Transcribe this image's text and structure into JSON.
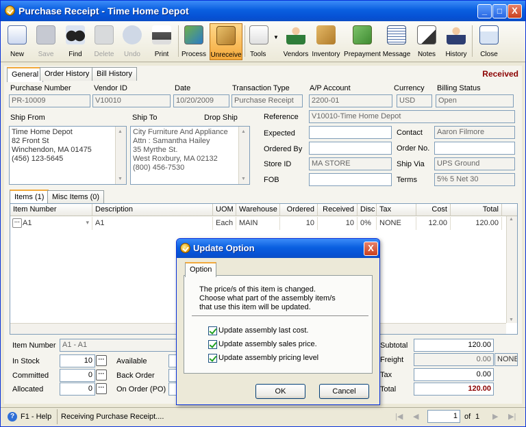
{
  "window": {
    "title": "Purchase Receipt - Time Home Depot",
    "minimize": "_",
    "maximize": "□",
    "close": "X"
  },
  "toolbar": [
    {
      "label": "New",
      "icon": "new-document-icon",
      "enabled": true
    },
    {
      "label": "Save",
      "icon": "save-disk-icon",
      "enabled": false
    },
    {
      "label": "Find",
      "icon": "binoculars-icon",
      "enabled": true
    },
    {
      "label": "Delete",
      "icon": "trash-icon",
      "enabled": false
    },
    {
      "label": "Undo",
      "icon": "undo-icon",
      "enabled": false
    },
    {
      "label": "Print",
      "icon": "printer-icon",
      "enabled": true
    },
    {
      "label": "Process",
      "icon": "process-icon",
      "enabled": true
    },
    {
      "label": "Unreceive",
      "icon": "unreceive-box-icon",
      "enabled": true,
      "active": true
    },
    {
      "label": "Tools",
      "icon": "tools-icon",
      "enabled": true,
      "dropdown": "▼"
    },
    {
      "label": "Vendors",
      "icon": "vendor-person-icon",
      "enabled": true
    },
    {
      "label": "Inventory",
      "icon": "inventory-boxes-icon",
      "enabled": true
    },
    {
      "label": "Prepayment",
      "icon": "prepayment-icon",
      "enabled": true
    },
    {
      "label": "Message",
      "icon": "message-icon",
      "enabled": true
    },
    {
      "label": "Notes",
      "icon": "notes-pen-icon",
      "enabled": true
    },
    {
      "label": "History",
      "icon": "history-person-icon",
      "enabled": true
    },
    {
      "label": "Close",
      "icon": "close-window-icon",
      "enabled": true
    }
  ],
  "tabs": [
    {
      "label": "General",
      "selected": true
    },
    {
      "label": "Order History"
    },
    {
      "label": "Bill History"
    }
  ],
  "status_badge": "Received",
  "header_fields": {
    "purchase_number": {
      "label": "Purchase Number",
      "value": "PR-10009"
    },
    "vendor_id": {
      "label": "Vendor ID",
      "value": "V10010"
    },
    "date": {
      "label": "Date",
      "value": "10/20/2009"
    },
    "transaction_type": {
      "label": "Transaction Type",
      "value": "Purchase Receipt"
    },
    "ap_account": {
      "label": "A/P Account",
      "value": "2200-01"
    },
    "currency": {
      "label": "Currency",
      "value": "USD"
    },
    "billing_status": {
      "label": "Billing Status",
      "value": "Open"
    }
  },
  "ship_from": {
    "label": "Ship From",
    "value": "Time Home Depot\n82 Front St\nWinchendon, MA 01475\n(456) 123-5645"
  },
  "ship_to": {
    "label": "Ship To",
    "value": "City Furniture And Appliance\nAttn : Samantha Hailey\n35 Myrthe St.\nWest Roxbury, MA 02132\n(800) 456-7530"
  },
  "drop_ship": {
    "label": "Drop Ship"
  },
  "right_fields": {
    "reference": {
      "label": "Reference",
      "value": "V10010-Time Home Depot"
    },
    "expected": {
      "label": "Expected",
      "value": ""
    },
    "contact": {
      "label": "Contact",
      "value": "Aaron Filmore"
    },
    "ordered_by": {
      "label": "Ordered By",
      "value": ""
    },
    "order_no": {
      "label": "Order No.",
      "value": ""
    },
    "store_id": {
      "label": "Store ID",
      "value": "MA STORE"
    },
    "ship_via": {
      "label": "Ship Via",
      "value": "UPS Ground"
    },
    "fob": {
      "label": "FOB",
      "value": ""
    },
    "terms": {
      "label": "Terms",
      "value": "5% 5 Net 30"
    }
  },
  "item_tabs": [
    {
      "label": "Items (1)",
      "selected": true
    },
    {
      "label": "Misc Items (0)"
    }
  ],
  "grid": {
    "columns": [
      "Item Number",
      "Description",
      "UOM",
      "Warehouse",
      "Ordered",
      "Received",
      "Disc",
      "Tax",
      "Cost",
      "Total"
    ],
    "rows": [
      {
        "item": "A1",
        "description": "A1",
        "uom": "Each",
        "warehouse": "MAIN",
        "ordered": "10",
        "received": "10",
        "disc": "0%",
        "tax": "NONE",
        "cost": "12.00",
        "total": "120.00"
      }
    ]
  },
  "bottom": {
    "item_number": {
      "label": "Item Number",
      "value": "A1 - A1"
    },
    "in_stock": {
      "label": "In Stock",
      "value": "10"
    },
    "committed": {
      "label": "Committed",
      "value": "0"
    },
    "allocated": {
      "label": "Allocated",
      "value": "0"
    },
    "available": {
      "label": "Available"
    },
    "back_order": {
      "label": "Back Order"
    },
    "on_order": {
      "label": "On Order (PO)"
    },
    "lookup_glyph": "···"
  },
  "totals": {
    "subtotal": {
      "label": "Subtotal",
      "value": "120.00"
    },
    "freight": {
      "label": "Freight",
      "value": "0.00",
      "code": "NONE"
    },
    "tax": {
      "label": "Tax",
      "value": "0.00"
    },
    "total": {
      "label": "Total",
      "value": "120.00"
    }
  },
  "statusbar": {
    "help": "F1 - Help",
    "message": "Receiving Purchase Receipt....",
    "page": "1",
    "of_label": "of",
    "total_pages": "1"
  },
  "dialog": {
    "title": "Update Option",
    "tab": "Option",
    "message": "The price/s of this item is changed.\nChoose what part of the assembly item/s\nthat use this item will be updated.",
    "options": [
      {
        "label": "Update assembly last cost.",
        "checked": true
      },
      {
        "label": "Update assembly sales price.",
        "checked": true
      },
      {
        "label": "Update assembly pricing level",
        "checked": true
      }
    ],
    "ok": "OK",
    "cancel": "Cancel"
  },
  "colors": {
    "accent": "#f2a93b",
    "title_blue": "#0a5fe0",
    "received": "#8b0000"
  }
}
